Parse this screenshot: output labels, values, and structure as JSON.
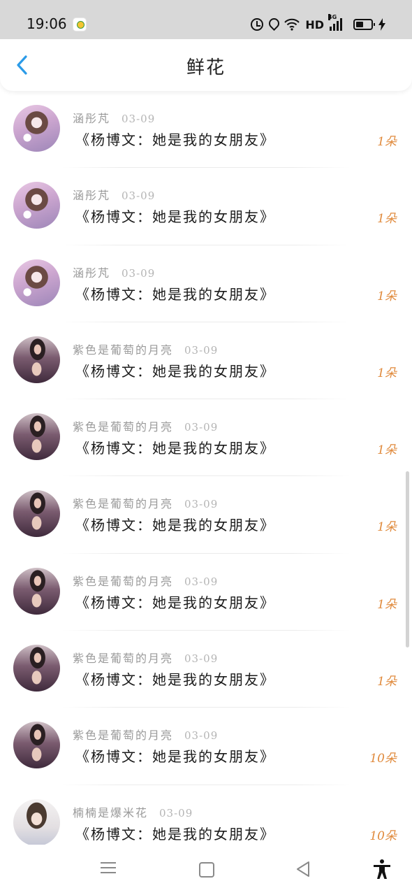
{
  "status_bar": {
    "time": "19:06",
    "network_label": "HD",
    "signal_label": "4G"
  },
  "header": {
    "title": "鲜花",
    "back_icon": "chevron-left-icon"
  },
  "colors": {
    "accent": "#2b9be8",
    "count": "#e08a3c",
    "name": "#9a9a9a"
  },
  "items": [
    {
      "name": "涵彤芃",
      "date": "03-09",
      "title": "《杨博文：她是我的女朋友》",
      "count": "1朵",
      "avatar": "style-a"
    },
    {
      "name": "涵彤芃",
      "date": "03-09",
      "title": "《杨博文：她是我的女朋友》",
      "count": "1朵",
      "avatar": "style-a"
    },
    {
      "name": "涵彤芃",
      "date": "03-09",
      "title": "《杨博文：她是我的女朋友》",
      "count": "1朵",
      "avatar": "style-a"
    },
    {
      "name": "紫色是葡萄的月亮",
      "date": "03-09",
      "title": "《杨博文：她是我的女朋友》",
      "count": "1朵",
      "avatar": "style-b"
    },
    {
      "name": "紫色是葡萄的月亮",
      "date": "03-09",
      "title": "《杨博文：她是我的女朋友》",
      "count": "1朵",
      "avatar": "style-b"
    },
    {
      "name": "紫色是葡萄的月亮",
      "date": "03-09",
      "title": "《杨博文：她是我的女朋友》",
      "count": "1朵",
      "avatar": "style-b"
    },
    {
      "name": "紫色是葡萄的月亮",
      "date": "03-09",
      "title": "《杨博文：她是我的女朋友》",
      "count": "1朵",
      "avatar": "style-b"
    },
    {
      "name": "紫色是葡萄的月亮",
      "date": "03-09",
      "title": "《杨博文：她是我的女朋友》",
      "count": "1朵",
      "avatar": "style-b"
    },
    {
      "name": "紫色是葡萄的月亮",
      "date": "03-09",
      "title": "《杨博文：她是我的女朋友》",
      "count": "10朵",
      "avatar": "style-b"
    },
    {
      "name": "楠楠是爆米花",
      "date": "03-09",
      "title": "《杨博文：她是我的女朋友》",
      "count": "10朵",
      "avatar": "style-c"
    }
  ],
  "nav": {
    "menu_icon": "menu-icon",
    "home_icon": "square-icon",
    "back_icon": "triangle-back-icon",
    "accessibility_icon": "accessibility-icon"
  }
}
